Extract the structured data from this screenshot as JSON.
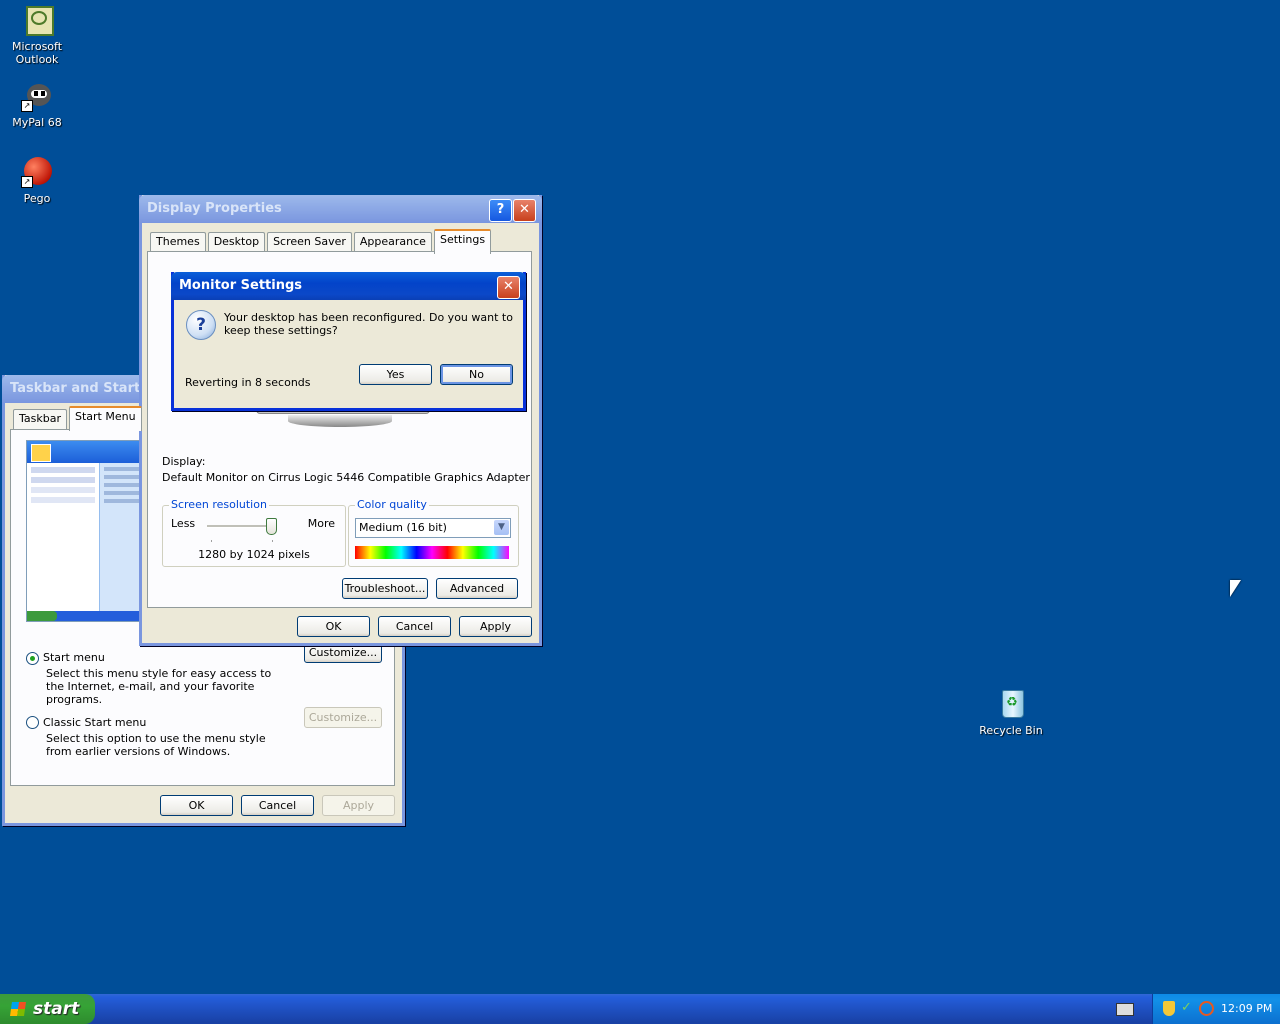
{
  "desktop": {
    "icons": [
      {
        "label": "Microsoft Outlook"
      },
      {
        "label": "MyPal 68"
      },
      {
        "label": "Pego"
      },
      {
        "label": "Recycle Bin"
      }
    ]
  },
  "taskbar_window": {
    "title": "Taskbar and Start Me",
    "tabs": [
      "Taskbar",
      "Start Menu"
    ],
    "option_start": {
      "label": "Start menu",
      "desc": "Select this menu style for easy access to the Internet, e-mail, and your favorite programs.",
      "customize": "Customize..."
    },
    "option_classic": {
      "label": "Classic Start menu",
      "desc": "Select this option to use the menu style from earlier versions of Windows.",
      "customize": "Customize..."
    },
    "ok": "OK",
    "cancel": "Cancel",
    "apply": "Apply"
  },
  "display_window": {
    "title": "Display Properties",
    "tabs": [
      "Themes",
      "Desktop",
      "Screen Saver",
      "Appearance",
      "Settings"
    ],
    "display_label": "Display:",
    "display_value": "Default Monitor on Cirrus Logic 5446 Compatible Graphics Adapter",
    "resolution": {
      "legend": "Screen resolution",
      "less": "Less",
      "more": "More",
      "value": "1280 by 1024 pixels"
    },
    "color": {
      "legend": "Color quality",
      "selected": "Medium (16 bit)"
    },
    "troubleshoot": "Troubleshoot...",
    "advanced": "Advanced",
    "ok": "OK",
    "cancel": "Cancel",
    "apply": "Apply"
  },
  "monitor_dialog": {
    "title": "Monitor Settings",
    "message": "Your desktop has been reconfigured.  Do you want to keep these settings?",
    "countdown": "Reverting in 8 seconds",
    "yes": "Yes",
    "no": "No"
  },
  "taskbar": {
    "start": "start",
    "clock": "12:09 PM"
  }
}
